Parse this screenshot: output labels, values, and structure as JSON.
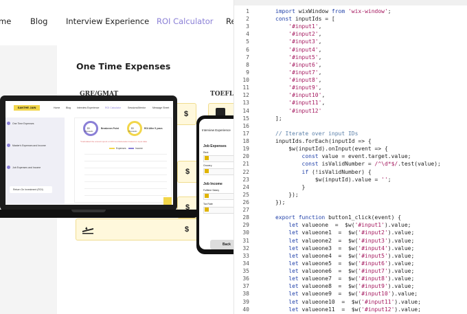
{
  "nav": {
    "items": [
      "me",
      "Blog",
      "Interview Experience",
      "ROI Calculator",
      "Re"
    ],
    "active_index": 3
  },
  "page": {
    "section_title": "One Time Expenses",
    "col_labels": [
      "GRE/GMAT",
      "TOEFL/I"
    ],
    "dollar": "$"
  },
  "laptop": {
    "logo": "SANTHE JAIN",
    "nav": [
      "Home",
      "Blog",
      "Interview Experience",
      "ROI Calculator",
      "Sessions/Mentor",
      "Message Sheet"
    ],
    "sidebar": [
      "One Time Expenses",
      "Master's Expenses and Income",
      "Job Expenses and Income"
    ],
    "sidebar_button": "Return On Investment (ROI)",
    "gauge1_value": "$0",
    "gauge1_unit": "Thousands",
    "gauge1_label": "Breakeven Point",
    "gauge2_value": "$0",
    "gauge2_unit": "Thousands",
    "gauge2_label": "ROI After 5 years",
    "note": "*Calculated the amount spent on ROI and Education based on input data",
    "legend": [
      "Expenses",
      "Income"
    ]
  },
  "phone": {
    "header": "Interview Experience",
    "section1": "Job Expenses",
    "label1": "Rent",
    "label2": "Grocery",
    "section2": "Job Income",
    "label3": "Fulltime Salary",
    "label4": "Tax Rate",
    "button": "Back"
  },
  "colors": {
    "accent": "#8a7fd6",
    "yellow": "#f2d64a",
    "keyword": "#1f3fa8",
    "string": "#a3155c",
    "comment": "#5a7fa8"
  },
  "editor": {
    "lines": [
      {
        "n": "1",
        "t": [
          [
            "k",
            "import "
          ],
          [
            "p",
            "wixWindow "
          ],
          [
            "k",
            "from "
          ],
          [
            "s",
            "'wix-window'"
          ],
          [
            "p",
            ";"
          ]
        ]
      },
      {
        "n": "2",
        "t": [
          [
            "k",
            "const "
          ],
          [
            "p",
            "inputIds = ["
          ]
        ]
      },
      {
        "n": "3",
        "t": [
          [
            "p",
            "    "
          ],
          [
            "s",
            "'#input1'"
          ],
          [
            "p",
            ","
          ]
        ]
      },
      {
        "n": "4",
        "t": [
          [
            "p",
            "    "
          ],
          [
            "s",
            "'#input2'"
          ],
          [
            "p",
            ","
          ]
        ]
      },
      {
        "n": "5",
        "t": [
          [
            "p",
            "    "
          ],
          [
            "s",
            "'#input3'"
          ],
          [
            "p",
            ","
          ]
        ]
      },
      {
        "n": "6",
        "t": [
          [
            "p",
            "    "
          ],
          [
            "s",
            "'#input4'"
          ],
          [
            "p",
            ","
          ]
        ]
      },
      {
        "n": "7",
        "t": [
          [
            "p",
            "    "
          ],
          [
            "s",
            "'#input5'"
          ],
          [
            "p",
            ","
          ]
        ]
      },
      {
        "n": "8",
        "t": [
          [
            "p",
            "    "
          ],
          [
            "s",
            "'#input6'"
          ],
          [
            "p",
            ","
          ]
        ]
      },
      {
        "n": "9",
        "t": [
          [
            "p",
            "    "
          ],
          [
            "s",
            "'#input7'"
          ],
          [
            "p",
            ","
          ]
        ]
      },
      {
        "n": "10",
        "t": [
          [
            "p",
            "    "
          ],
          [
            "s",
            "'#input8'"
          ],
          [
            "p",
            ","
          ]
        ]
      },
      {
        "n": "11",
        "t": [
          [
            "p",
            "    "
          ],
          [
            "s",
            "'#input9'"
          ],
          [
            "p",
            ","
          ]
        ]
      },
      {
        "n": "12",
        "t": [
          [
            "p",
            "    "
          ],
          [
            "s",
            "'#input10'"
          ],
          [
            "p",
            ","
          ]
        ]
      },
      {
        "n": "13",
        "t": [
          [
            "p",
            "    "
          ],
          [
            "s",
            "'#input11'"
          ],
          [
            "p",
            ","
          ]
        ]
      },
      {
        "n": "14",
        "t": [
          [
            "p",
            "    "
          ],
          [
            "s",
            "'#input12'"
          ]
        ]
      },
      {
        "n": "15",
        "t": [
          [
            "p",
            "];"
          ]
        ]
      },
      {
        "n": "16",
        "t": [
          [
            "p",
            ""
          ]
        ]
      },
      {
        "n": "17",
        "t": [
          [
            "c",
            "// Iterate over input IDs"
          ]
        ]
      },
      {
        "n": "18",
        "t": [
          [
            "p",
            "inputIds.forEach(inputId => {"
          ]
        ]
      },
      {
        "n": "19",
        "t": [
          [
            "p",
            "    $w(inputId).onInput(event => {"
          ]
        ]
      },
      {
        "n": "20",
        "t": [
          [
            "p",
            "        "
          ],
          [
            "k",
            "const "
          ],
          [
            "p",
            "value = event.target.value;"
          ]
        ]
      },
      {
        "n": "21",
        "t": [
          [
            "p",
            "        "
          ],
          [
            "k",
            "const "
          ],
          [
            "p",
            "isValidNumber = "
          ],
          [
            "s",
            "/^\\d*$/"
          ],
          [
            "p",
            ".test(value);"
          ]
        ]
      },
      {
        "n": "22",
        "t": [
          [
            "p",
            "        "
          ],
          [
            "k",
            "if "
          ],
          [
            "p",
            "(!isValidNumber) {"
          ]
        ]
      },
      {
        "n": "23",
        "t": [
          [
            "p",
            "            $w(inputId).value = "
          ],
          [
            "s",
            "''"
          ],
          [
            "p",
            ";"
          ]
        ]
      },
      {
        "n": "24",
        "t": [
          [
            "p",
            "        }"
          ]
        ]
      },
      {
        "n": "25",
        "t": [
          [
            "p",
            "    });"
          ]
        ]
      },
      {
        "n": "26",
        "t": [
          [
            "p",
            "});"
          ]
        ]
      },
      {
        "n": "27",
        "t": [
          [
            "p",
            ""
          ]
        ]
      },
      {
        "n": "28",
        "t": [
          [
            "k",
            "export function "
          ],
          [
            "p",
            "button1_click(event) {"
          ]
        ]
      },
      {
        "n": "29",
        "t": [
          [
            "p",
            "    "
          ],
          [
            "k",
            "let "
          ],
          [
            "p",
            "valueone  =  $w("
          ],
          [
            "s",
            "'#input1'"
          ],
          [
            "p",
            ").value;"
          ]
        ]
      },
      {
        "n": "30",
        "t": [
          [
            "p",
            "    "
          ],
          [
            "k",
            "let "
          ],
          [
            "p",
            "valueone1  =  $w("
          ],
          [
            "s",
            "'#input2'"
          ],
          [
            "p",
            ").value;"
          ]
        ]
      },
      {
        "n": "31",
        "t": [
          [
            "p",
            "    "
          ],
          [
            "k",
            "let "
          ],
          [
            "p",
            "valueone2  =  $w("
          ],
          [
            "s",
            "'#input3'"
          ],
          [
            "p",
            ").value;"
          ]
        ]
      },
      {
        "n": "32",
        "t": [
          [
            "p",
            "    "
          ],
          [
            "k",
            "let "
          ],
          [
            "p",
            "valueone3  =  $w("
          ],
          [
            "s",
            "'#input4'"
          ],
          [
            "p",
            ").value;"
          ]
        ]
      },
      {
        "n": "33",
        "t": [
          [
            "p",
            "    "
          ],
          [
            "k",
            "let "
          ],
          [
            "p",
            "valueone4  =  $w("
          ],
          [
            "s",
            "'#input5'"
          ],
          [
            "p",
            ").value;"
          ]
        ]
      },
      {
        "n": "34",
        "t": [
          [
            "p",
            "    "
          ],
          [
            "k",
            "let "
          ],
          [
            "p",
            "valueone5  =  $w("
          ],
          [
            "s",
            "'#input6'"
          ],
          [
            "p",
            ").value;"
          ]
        ]
      },
      {
        "n": "35",
        "t": [
          [
            "p",
            "    "
          ],
          [
            "k",
            "let "
          ],
          [
            "p",
            "valueone6  =  $w("
          ],
          [
            "s",
            "'#input7'"
          ],
          [
            "p",
            ").value;"
          ]
        ]
      },
      {
        "n": "36",
        "t": [
          [
            "p",
            "    "
          ],
          [
            "k",
            "let "
          ],
          [
            "p",
            "valueone7  =  $w("
          ],
          [
            "s",
            "'#input8'"
          ],
          [
            "p",
            ").value;"
          ]
        ]
      },
      {
        "n": "37",
        "t": [
          [
            "p",
            "    "
          ],
          [
            "k",
            "let "
          ],
          [
            "p",
            "valueone8  =  $w("
          ],
          [
            "s",
            "'#input9'"
          ],
          [
            "p",
            ").value;"
          ]
        ]
      },
      {
        "n": "38",
        "t": [
          [
            "p",
            "    "
          ],
          [
            "k",
            "let "
          ],
          [
            "p",
            "valueone9  =  $w("
          ],
          [
            "s",
            "'#input10'"
          ],
          [
            "p",
            ").value;"
          ]
        ]
      },
      {
        "n": "39",
        "t": [
          [
            "p",
            "    "
          ],
          [
            "k",
            "let "
          ],
          [
            "p",
            "valueone10  =  $w("
          ],
          [
            "s",
            "'#input11'"
          ],
          [
            "p",
            ").value;"
          ]
        ]
      },
      {
        "n": "40",
        "t": [
          [
            "p",
            "    "
          ],
          [
            "k",
            "let "
          ],
          [
            "p",
            "valueone11  =  $w("
          ],
          [
            "s",
            "'#input12'"
          ],
          [
            "p",
            ").value;"
          ]
        ]
      }
    ]
  }
}
